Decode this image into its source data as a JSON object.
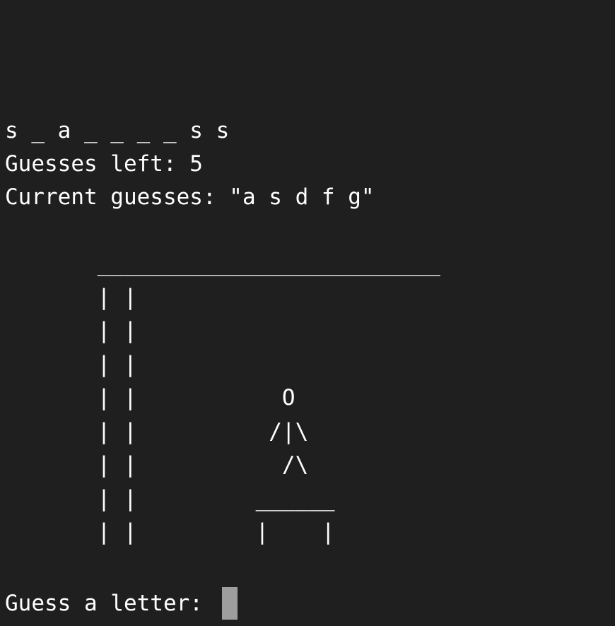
{
  "terminal": {
    "word_progress": "s _ a _ _ _ _ s s",
    "guesses_left": "Guesses left: 5",
    "current_guesses": "Current guesses: \"a s d f g\"",
    "hangman_art": "       __________________________\n       | |\n       | |\n       | |\n       | |           O\n       | |          /|\\\n       | |           /\\\n       | |         ______\n       | |         |    |",
    "prompt": "Guess a letter: "
  },
  "colors": {
    "background": "#1f1f1f",
    "text": "#ffffff",
    "cursor": "#9e9e9e"
  }
}
